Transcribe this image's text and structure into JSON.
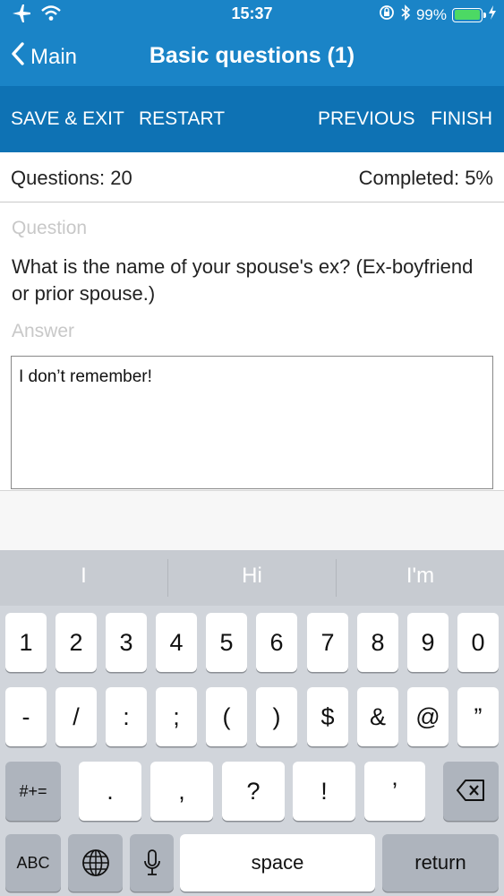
{
  "status_bar": {
    "time": "15:37",
    "battery_text": "99%",
    "battery_level": 0.99,
    "icons": [
      "airplane-icon",
      "wifi-icon",
      "orientation-lock-icon",
      "bluetooth-icon",
      "battery-icon",
      "charging-icon"
    ],
    "battery_color": "#4cd964"
  },
  "nav": {
    "back_label": "Main",
    "title": "Basic questions (1)"
  },
  "toolbar": {
    "save_exit": "SAVE & EXIT",
    "restart": "RESTART",
    "previous": "PREVIOUS",
    "finish": "FINISH"
  },
  "progress": {
    "questions": "Questions: 20",
    "completed": "Completed: 5%"
  },
  "form": {
    "question_label": "Question",
    "question_text": "What is the name of your spouse's ex? (Ex-boyfriend or prior spouse.)",
    "answer_label": "Answer",
    "answer_value": "I don’t remember!"
  },
  "keyboard": {
    "suggestions": [
      "I",
      "Hi",
      "I'm"
    ],
    "row1": [
      "1",
      "2",
      "3",
      "4",
      "5",
      "6",
      "7",
      "8",
      "9",
      "0"
    ],
    "row2": [
      "-",
      "/",
      ":",
      ";",
      "(",
      ")",
      "$",
      "&",
      "@",
      "”"
    ],
    "row3": [
      ".",
      ",",
      "?",
      "!",
      "’"
    ],
    "symbols_key": "#+=",
    "abc_key": "ABC",
    "space_key": "space",
    "return_key": "return"
  },
  "colors": {
    "header_blue": "#1a84c7",
    "toolbar_blue": "#0e72b4"
  }
}
